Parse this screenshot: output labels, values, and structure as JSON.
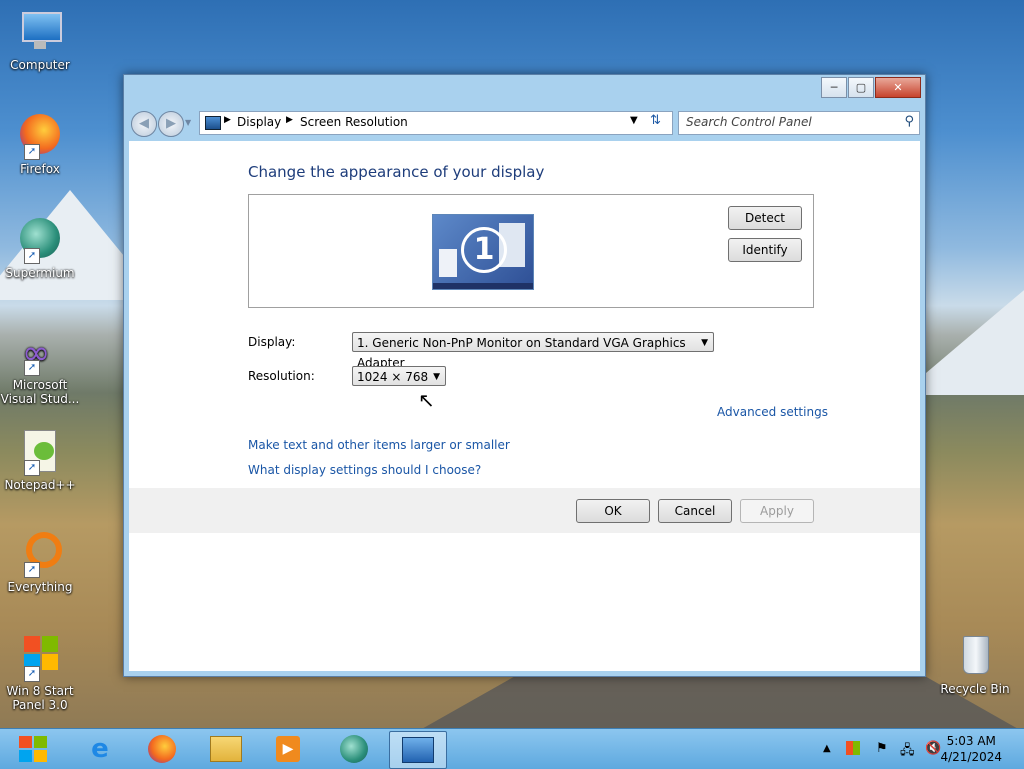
{
  "desktop": {
    "icons": [
      {
        "label": "Computer"
      },
      {
        "label": "Firefox"
      },
      {
        "label": "Supermium"
      },
      {
        "label": "Microsoft Visual Stud..."
      },
      {
        "label": "Notepad++"
      },
      {
        "label": "Everything"
      },
      {
        "label": "Win 8 Start Panel 3.0"
      },
      {
        "label": "Recycle Bin"
      }
    ]
  },
  "window": {
    "caption": {
      "minimize": "─",
      "maximize": "▢",
      "close": "✕"
    },
    "breadcrumb": [
      "Display",
      "Screen Resolution"
    ],
    "search_placeholder": "Search Control Panel",
    "heading": "Change the appearance of your display",
    "monitor_number": "1",
    "detect_label": "Detect",
    "identify_label": "Identify",
    "display_label": "Display:",
    "display_value": "1. Generic Non-PnP Monitor on Standard VGA Graphics Adapter",
    "resolution_label": "Resolution:",
    "resolution_value": "1024 × 768",
    "advanced_link": "Advanced settings",
    "link_text_size": "Make text and other items larger or smaller",
    "link_help": "What display settings should I choose?",
    "ok_label": "OK",
    "cancel_label": "Cancel",
    "apply_label": "Apply"
  },
  "taskbar": {
    "clock_time": "5:03 AM",
    "clock_date": "4/21/2024"
  },
  "colors": {
    "accent": "#1a56a6",
    "heading": "#1e3d7b",
    "taskbar": "#5ea9df"
  }
}
